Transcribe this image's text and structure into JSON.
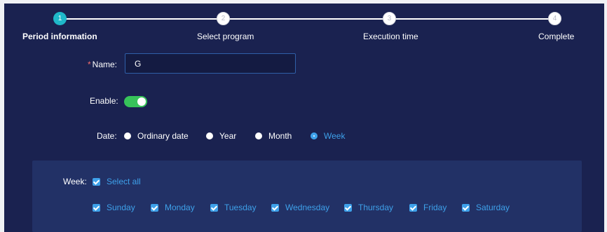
{
  "steps": [
    {
      "number": "1",
      "label": "Period information",
      "state": "active"
    },
    {
      "number": "2",
      "label": "Select program",
      "state": "todo"
    },
    {
      "number": "3",
      "label": "Execution time",
      "state": "todo"
    },
    {
      "number": "4",
      "label": "Complete",
      "state": "todo"
    }
  ],
  "form": {
    "name": {
      "required_mark": "*",
      "label": "Name:",
      "value": "G"
    },
    "enable": {
      "label": "Enable:",
      "on": true
    },
    "date": {
      "label": "Date:",
      "options": [
        "Ordinary date",
        "Year",
        "Month",
        "Week"
      ],
      "selected": "Week"
    },
    "week": {
      "label": "Week:",
      "select_all": "Select all",
      "days": [
        "Sunday",
        "Monday",
        "Tuesday",
        "Wednesday",
        "Thursday",
        "Friday",
        "Saturday"
      ],
      "all_checked": true
    }
  },
  "colors": {
    "panel_bg": "#1a2250",
    "week_box_bg": "#223166",
    "accent_blue": "#3ea1ea",
    "active_step": "#1fb8c9",
    "switch_on": "#37c35a",
    "required": "#f56c6c"
  }
}
